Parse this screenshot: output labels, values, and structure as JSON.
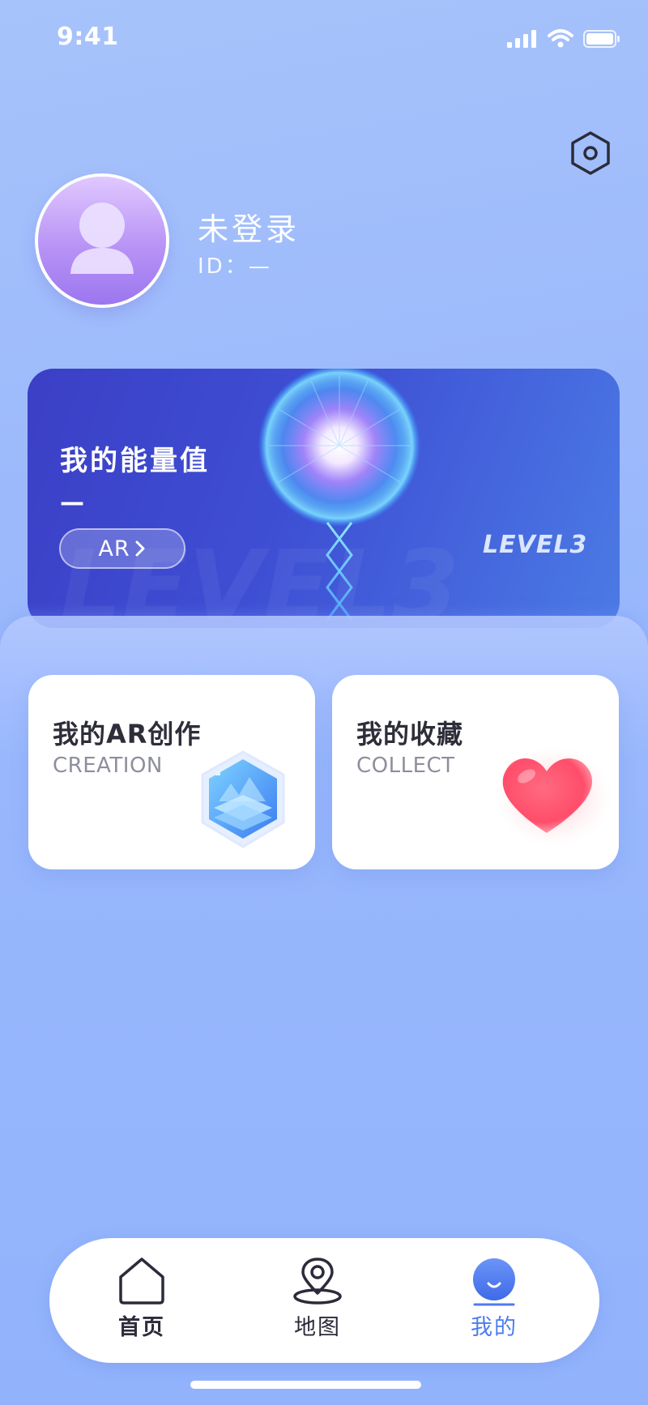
{
  "status_bar": {
    "time": "9:41"
  },
  "profile": {
    "name": "未登录",
    "id_text": "ID：—"
  },
  "energy_card": {
    "title": "我的能量值",
    "value": "—",
    "ar_button_label": "AR",
    "level_badge": "LEVEL3"
  },
  "cards": [
    {
      "title": "我的AR创作",
      "subtitle": "CREATION",
      "icon": "layers-icon"
    },
    {
      "title": "我的收藏",
      "subtitle": "COLLECT",
      "icon": "heart-icon"
    }
  ],
  "tabbar": {
    "items": [
      {
        "label": "首页",
        "icon": "home-icon",
        "active": false
      },
      {
        "label": "地图",
        "icon": "map-pin-icon",
        "active": false
      },
      {
        "label": "我的",
        "icon": "profile-face-icon",
        "active": true
      }
    ]
  },
  "colors": {
    "accent": "#4d7cf0",
    "background": "#94b5fc",
    "card_gradient_start": "#3b3fc6",
    "heart": "#ff5b73"
  }
}
